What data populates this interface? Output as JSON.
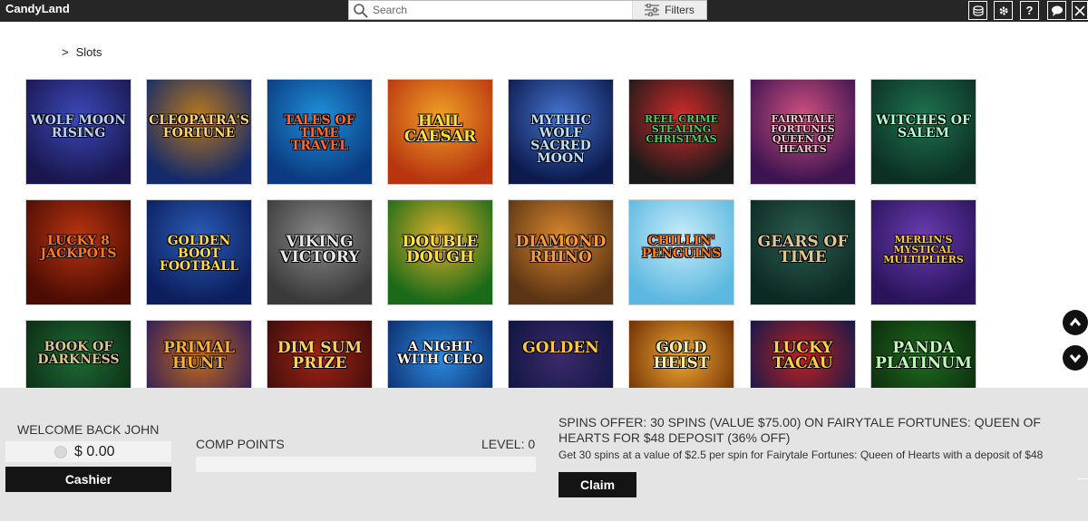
{
  "app": {
    "title": "CandyLand"
  },
  "search": {
    "placeholder": "Search",
    "filters_label": "Filters"
  },
  "toolbar": {
    "buttons": [
      "coins-icon",
      "gear-icon",
      "help-icon",
      "chat-icon",
      "close-icon"
    ],
    "help_glyph": "?"
  },
  "breadcrumb": {
    "separator": ">",
    "current": "Slots"
  },
  "games": [
    {
      "title": "WOLF MOON RISING",
      "bg": [
        "#1a1750",
        "#3c49b8"
      ],
      "color": "#b8d2ff"
    },
    {
      "title": "CLEOPATRA'S FORTUNE",
      "bg": [
        "#142a6a",
        "#b8781c"
      ],
      "color": "#ffd46a"
    },
    {
      "title": "TALES OF TIME TRAVEL",
      "bg": [
        "#0a3a80",
        "#1f90d8"
      ],
      "color": "#ff6a2c"
    },
    {
      "title": "HAIL CAESAR",
      "bg": [
        "#b83510",
        "#f0a026"
      ],
      "color": "#ffdf3c"
    },
    {
      "title": "MYTHIC WOLF SACRED MOON",
      "bg": [
        "#0c1a4c",
        "#4474d0"
      ],
      "color": "#b8e0ff"
    },
    {
      "title": "REEL CRIME STEALING CHRISTMAS",
      "bg": [
        "#1a1a1a",
        "#d02a2a"
      ],
      "color": "#4cd04c"
    },
    {
      "title": "FAIRYTALE FORTUNES QUEEN OF HEARTS",
      "bg": [
        "#3c1450",
        "#d05080"
      ],
      "color": "#ffc0d8"
    },
    {
      "title": "WITCHES OF SALEM",
      "bg": [
        "#0c3024",
        "#1e7250"
      ],
      "color": "#a8ffd4"
    },
    {
      "title": "LUCKY 8 JACKPOTS",
      "bg": [
        "#4c0c04",
        "#b83410"
      ],
      "color": "#ff7a1c"
    },
    {
      "title": "GOLDEN BOOT FOOTBALL",
      "bg": [
        "#0c1e5c",
        "#2a5cb8"
      ],
      "color": "#ffd84c"
    },
    {
      "title": "VIKING VICTORY",
      "bg": [
        "#3a3a3a",
        "#8a8a8a"
      ],
      "color": "#e8e8e8"
    },
    {
      "title": "DOUBLE DOUGH",
      "bg": [
        "#1a6a1a",
        "#e0b028"
      ],
      "color": "#ffe04c"
    },
    {
      "title": "DIAMOND RHINO",
      "bg": [
        "#5a3414",
        "#d8862c"
      ],
      "color": "#ff9a3c"
    },
    {
      "title": "CHILLIN' PENGUINS",
      "bg": [
        "#5cb8e0",
        "#c8ecfa"
      ],
      "color": "#ff7a1c"
    },
    {
      "title": "GEARS OF TIME",
      "bg": [
        "#0c2a24",
        "#2c5c50"
      ],
      "color": "#e0c890"
    },
    {
      "title": "MERLIN'S MYSTICAL MULTIPLIERS",
      "bg": [
        "#2a145c",
        "#6a3cb0"
      ],
      "color": "#ffc83c"
    },
    {
      "title": "BOOK OF DARKNESS",
      "bg": [
        "#0c2a14",
        "#1e6a34"
      ],
      "color": "#d8c890"
    },
    {
      "title": "PRIMAL HUNT",
      "bg": [
        "#2c1a5c",
        "#c06a1c"
      ],
      "color": "#ffb030"
    },
    {
      "title": "DIM SUM PRIZE",
      "bg": [
        "#3a0c0c",
        "#a02414"
      ],
      "color": "#ffd060"
    },
    {
      "title": "A NIGHT WITH CLEO",
      "bg": [
        "#0c2a6a",
        "#2c8ce0"
      ],
      "color": "#ffffff"
    },
    {
      "title": "GOLDEN",
      "bg": [
        "#0c1440",
        "#3c2a6a"
      ],
      "color": "#ffc83c"
    },
    {
      "title": "GOLD HEIST",
      "bg": [
        "#6a2a04",
        "#f0a830"
      ],
      "color": "#fff0a0"
    },
    {
      "title": "LUCKY TACAU",
      "bg": [
        "#0c1a4c",
        "#c02020"
      ],
      "color": "#ffd040"
    },
    {
      "title": "PANDA PLATINUM",
      "bg": [
        "#0c2a0c",
        "#1e6a1e"
      ],
      "color": "#b8ffb0"
    }
  ],
  "player": {
    "welcome": "WELCOME BACK JOHN",
    "balance": "$ 0.00",
    "cashier_label": "Cashier",
    "comp_points_label": "COMP POINTS",
    "level_label": "LEVEL: 0",
    "comp_progress": 0
  },
  "offer": {
    "title": "SPINS OFFER: 30 SPINS (VALUE $75.00) ON FAIRYTALE FORTUNES: QUEEN OF HEARTS FOR $48 DEPOSIT (36% OFF)",
    "description": "Get 30 spins at a value of $2.5 per spin for Fairytale Fortunes: Queen of Hearts with a deposit of $48",
    "claim_label": "Claim"
  }
}
